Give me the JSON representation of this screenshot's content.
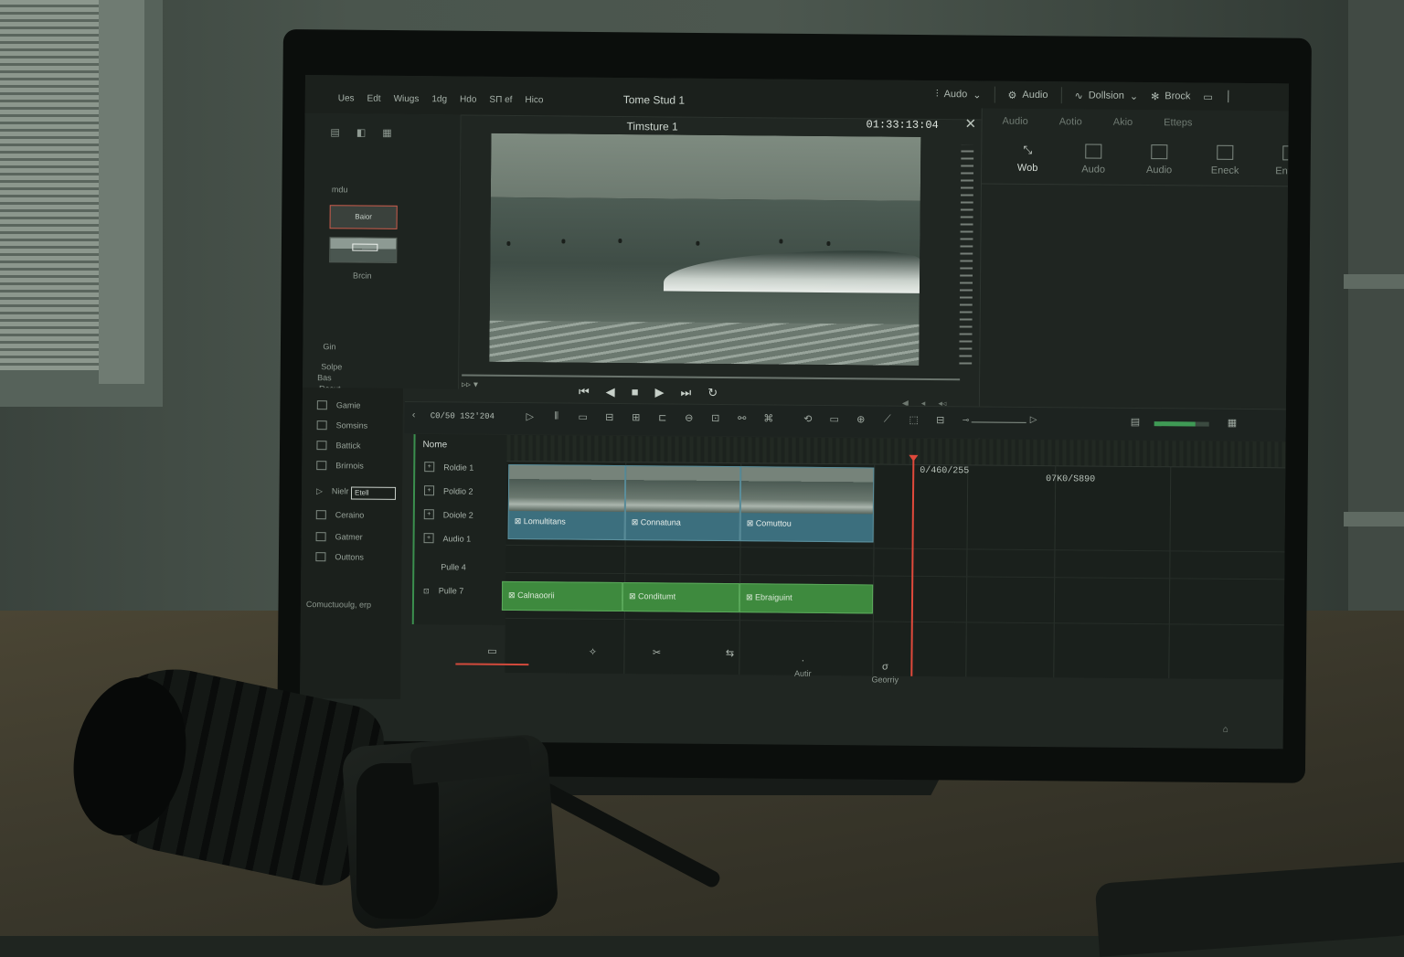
{
  "app": {
    "menu": [
      "Ues",
      "Edt",
      "Wiugs",
      "1dg",
      "Hdo",
      "SΠ ef",
      "Hico"
    ],
    "project_title": "Tome Stud 1",
    "top_right": {
      "workspace": "Audo",
      "audio": "Audio",
      "dollsion": "Dollsion",
      "brock": "Brock"
    }
  },
  "media_panel": {
    "section_label": "mdu",
    "thumb1_label": "Baior",
    "thumb2_caption": "Brcin",
    "options": [
      "Gin",
      "Solpe",
      "Recut"
    ],
    "bin_label": "Bas"
  },
  "viewer": {
    "title": "Timsture 1",
    "timecode": "01:33:13:04"
  },
  "inspector": {
    "tabs": [
      "Audio",
      "Aotio",
      "Akio",
      "Etteps"
    ],
    "tools": [
      "Wob",
      "Audo",
      "Audio",
      "Eneck",
      "Enfecc"
    ]
  },
  "left_list": {
    "items": [
      "Gamie",
      "Somsins",
      "Battick",
      "Brirnois"
    ],
    "filter_label": "Nielr",
    "filter_value": "Etell",
    "items2": [
      "Ceraino",
      "Gatmer",
      "Outtons"
    ],
    "footer": "Comuctuoulg, erp"
  },
  "timeline": {
    "timecode": "C0/50 1S2'204",
    "header_title": "Nome",
    "tracks": [
      "Roldie 1",
      "Poldio 2",
      "Doiole 2",
      "Audio 1",
      "Pulle 4",
      "Pulle 7"
    ],
    "video_clips": [
      "Lomultitans",
      "Connatuna",
      "Comuttou"
    ],
    "audio_clips": [
      "Calnaoorii",
      "Conditumt",
      "Ebraiguint"
    ],
    "playhead_tc": "0/460/255",
    "marker_tc": "07K0/S890",
    "zoom_level": 0.75
  },
  "page_tabs": [
    "",
    "",
    "",
    "",
    "Autir",
    "Georriy"
  ],
  "colors": {
    "accent_red": "#e0493b",
    "video_clip": "#3c6f7e",
    "audio_clip": "#3e8a3e",
    "track_accent": "#3b8f4e"
  }
}
